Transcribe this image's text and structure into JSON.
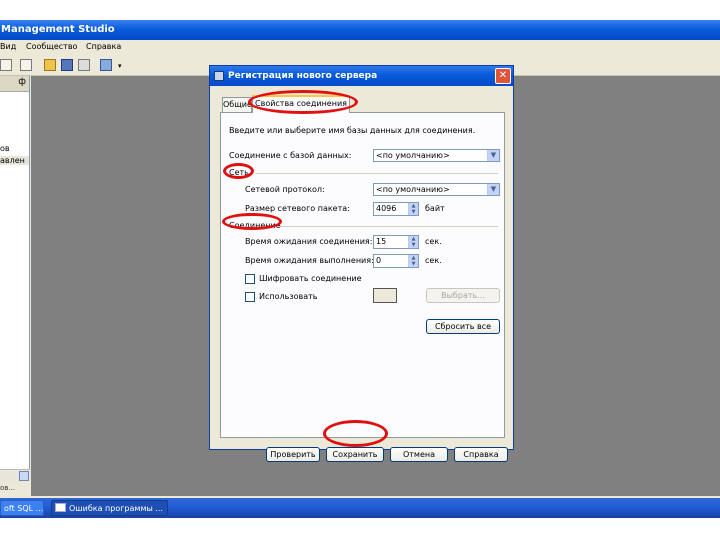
{
  "main_window": {
    "title": "Management Studio",
    "menu": [
      "Вид",
      "Сообщество",
      "Справка"
    ]
  },
  "left_panel": {
    "pin_glyph": "ф",
    "tree_lines": [
      "ов",
      "авлен"
    ],
    "status": "ов..."
  },
  "dialog": {
    "title": "Регистрация нового сервера",
    "close_glyph": "✕",
    "tabs": [
      "Общие",
      "Свойства соединения"
    ],
    "intro_text": "Введите или выберите имя базы данных для соединения.",
    "db_connect_label": "Соединение с базой данных:",
    "db_connect_value": "<по умолчанию>",
    "network_section": "Сеть",
    "protocol_label": "Сетевой протокол:",
    "protocol_value": "<по умолчанию>",
    "packet_label": "Размер сетевого пакета:",
    "packet_value": "4096",
    "packet_unit": "байт",
    "connection_section": "Соединение",
    "conn_timeout_label": "Время ожидания соединения:",
    "conn_timeout_value": "15",
    "exec_timeout_label": "Время ожидания выполнения:",
    "exec_timeout_value": "0",
    "sec_unit": "сек.",
    "encrypt_label": "Шифровать соединение",
    "custom_color_label": "Использовать",
    "select_button": "Выбрать...",
    "reset_button": "Сбросить все",
    "buttons": {
      "test": "Проверить",
      "save": "Сохранить",
      "cancel": "Отмена",
      "help": "Справка"
    }
  },
  "taskbar": {
    "items": [
      "oft SQL ...",
      "Ошибка программы ..."
    ]
  },
  "colors": {
    "highlight": "#e01010",
    "title_blue": "#0a5bd8",
    "workspace": "#808080"
  },
  "icons": [
    "new-query-icon",
    "document-icon",
    "open-folder-icon",
    "save-icon",
    "print-icon",
    "config-icon",
    "dropdown-arrow-icon"
  ]
}
